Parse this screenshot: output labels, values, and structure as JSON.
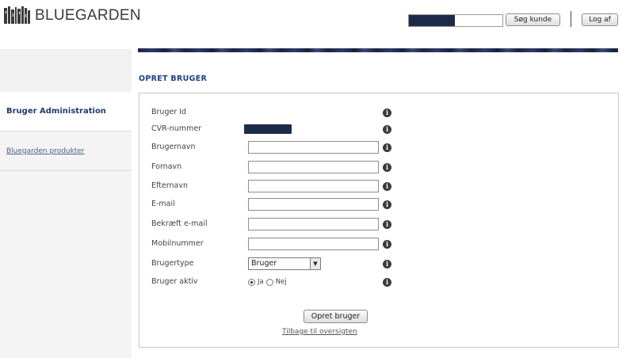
{
  "header": {
    "brand": "BLUEGARDEN",
    "search_button": "Søg kunde",
    "logout_button": "Log af"
  },
  "sidebar": {
    "items": [
      {
        "label": "Bruger Administration",
        "active": true
      },
      {
        "label": "Bluegarden produkter",
        "active": false
      }
    ]
  },
  "main": {
    "title": "OPRET BRUGER",
    "fields": {
      "user_id": {
        "label": "Bruger Id"
      },
      "cvr": {
        "label": "CVR-nummer"
      },
      "username": {
        "label": "Brugernavn",
        "value": ""
      },
      "firstname": {
        "label": "Fornavn",
        "value": ""
      },
      "lastname": {
        "label": "Efternavn",
        "value": ""
      },
      "email": {
        "label": "E-mail",
        "value": ""
      },
      "email_confirm": {
        "label": "Bekræft e-mail",
        "value": ""
      },
      "mobile": {
        "label": "Mobilnummer",
        "value": ""
      },
      "usertype": {
        "label": "Brugertype",
        "selected": "Bruger"
      },
      "active": {
        "label": "Bruger aktiv",
        "options": [
          "Ja",
          "Nej"
        ],
        "selected": "Ja"
      }
    },
    "create_button": "Opret bruger",
    "back_link": "Tilbage til oversigten"
  },
  "colors": {
    "accent": "#1f3f85",
    "redaction": "#1d2b4a",
    "sidebar_bg": "#f4f4f4"
  },
  "icons": [
    "bluegarden-logo-icon",
    "info-icon",
    "dropdown-arrow-icon"
  ]
}
